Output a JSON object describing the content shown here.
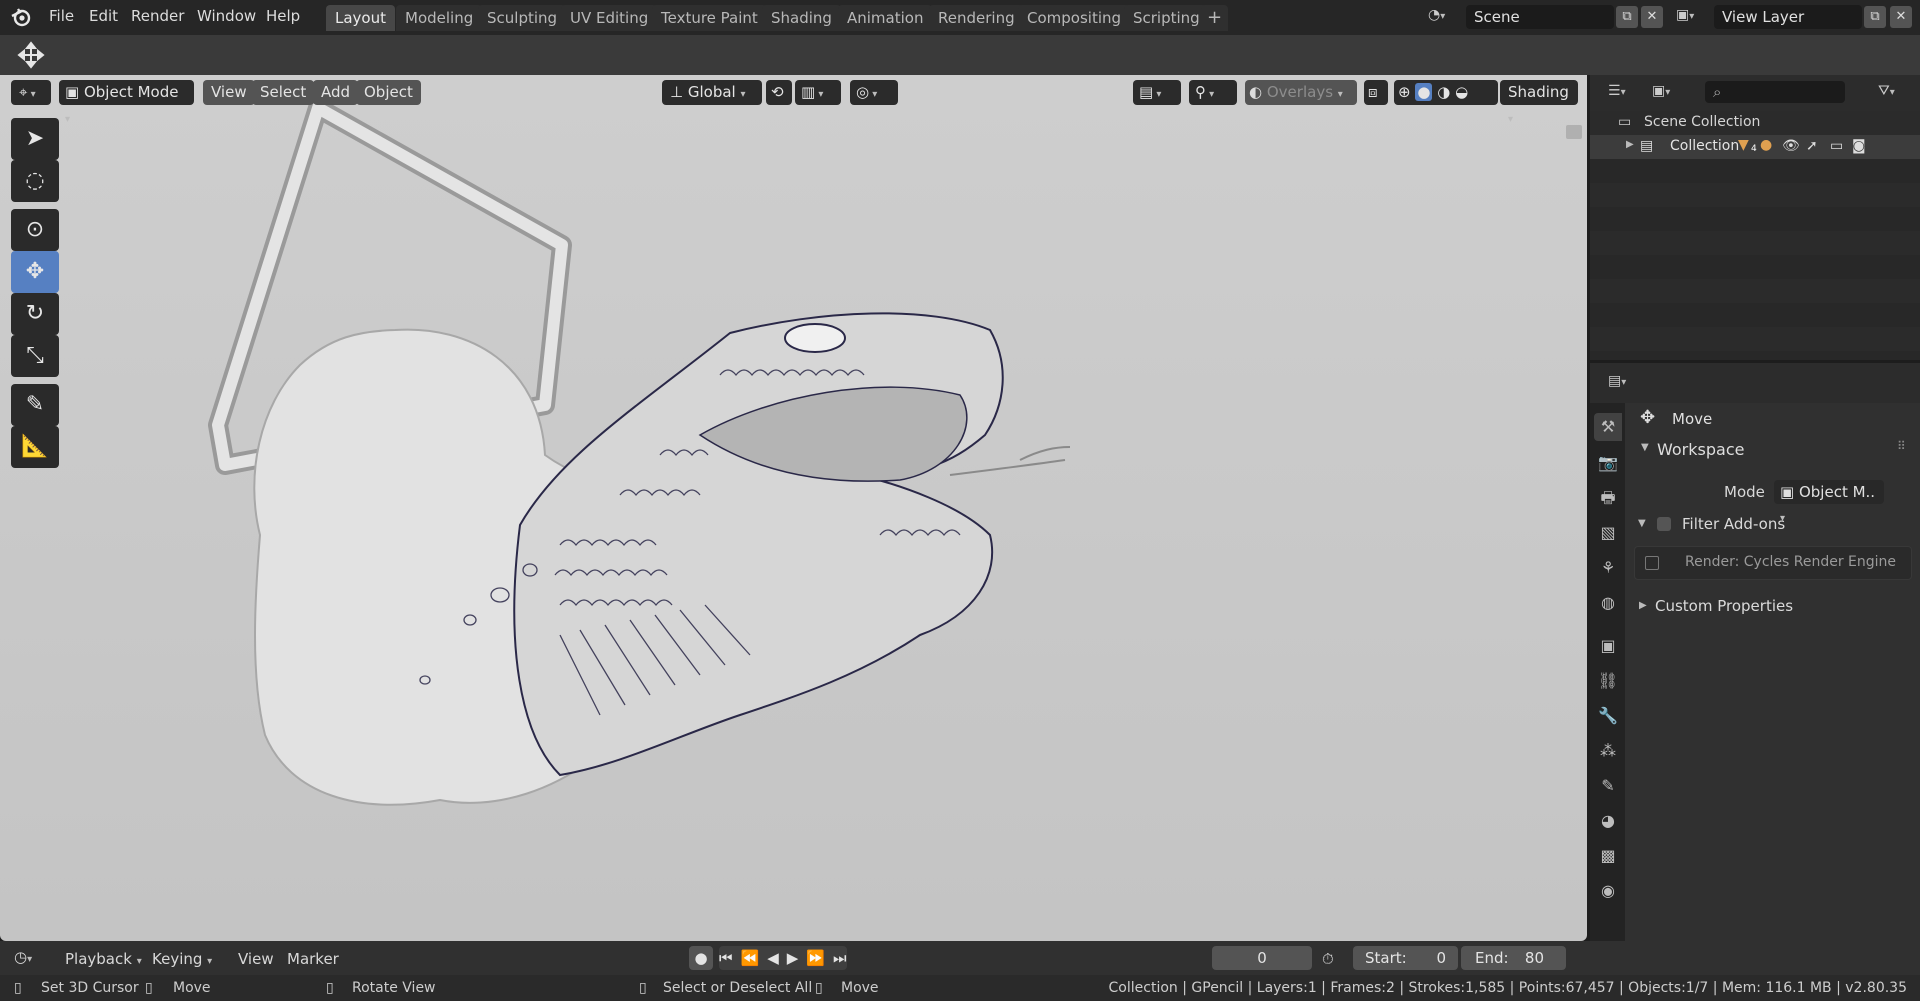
{
  "menu": [
    "File",
    "Edit",
    "Render",
    "Window",
    "Help"
  ],
  "workspaces": [
    "Layout",
    "Modeling",
    "Sculpting",
    "UV Editing",
    "Texture Paint",
    "Shading",
    "Animation",
    "Rendering",
    "Compositing",
    "Scripting"
  ],
  "active_workspace": "Layout",
  "scene": {
    "name": "Scene"
  },
  "view_layer": {
    "name": "View Layer"
  },
  "viewport_header": {
    "mode": "Object Mode",
    "menus": [
      "View",
      "Select",
      "Add",
      "Object"
    ],
    "transform_orientation": "Global",
    "overlays_label": "Overlays",
    "shading_label": "Shading"
  },
  "outliner": {
    "root": "Scene Collection",
    "collection": "Collection",
    "collection_badge": "4"
  },
  "properties": {
    "tool_name": "Move",
    "workspace_label": "Workspace",
    "mode_label": "Mode",
    "mode_value": "Object M..",
    "filter_addons_label": "Filter Add-ons",
    "addon_item": "Render: Cycles Render Engine",
    "custom_properties_label": "Custom Properties"
  },
  "timeline": {
    "menus": [
      "Playback",
      "Keying",
      "View",
      "Marker"
    ],
    "current_frame": "0",
    "start_label": "Start:",
    "start_value": "0",
    "end_label": "End:",
    "end_value": "80"
  },
  "statusbar": {
    "set_cursor": "Set 3D Cursor",
    "move": "Move",
    "rotate_view": "Rotate View",
    "select_all": "Select or Deselect All",
    "move2": "Move",
    "stats": "Collection | GPencil | Layers:1 | Frames:2 | Strokes:1,585 | Points:67,457 | Objects:1/7 | Mem: 116.1 MB | v2.80.35"
  },
  "colors": {
    "accent": "#5680c2",
    "panel_bg": "#303030",
    "viewport_bg": "#c8c8c8",
    "stroke_ink": "#2a2848"
  }
}
